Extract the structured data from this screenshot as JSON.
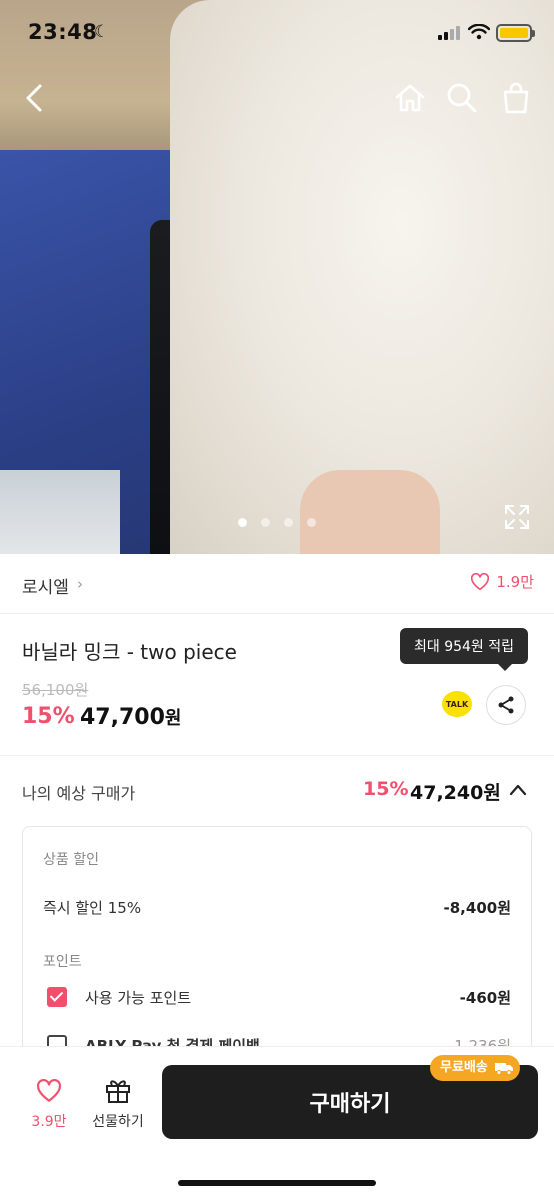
{
  "status_bar": {
    "time": "23:48"
  },
  "gallery": {
    "page_count": 4,
    "active_index": 0
  },
  "seller": {
    "name": "로시엘",
    "like_count": "1.9만"
  },
  "product": {
    "title": "바닐라 밍크 - two piece",
    "original_price": "56,100원",
    "discount_rate": "15%",
    "price_number": "47,700",
    "price_unit": "원",
    "tooltip": "최대 954원 적립",
    "talk_label": "TALK"
  },
  "estimate": {
    "label": "나의 예상 구매가",
    "discount_rate": "15%",
    "price": "47,240원"
  },
  "breakdown": {
    "discount_section": "상품 할인",
    "instant_label": "즉시 할인 15%",
    "instant_value": "-8,400원",
    "point_section": "포인트",
    "points_label": "사용 가능 포인트",
    "points_value": "-460원",
    "ablypay_label": "ABLY Pay 첫 결제 페이백",
    "ablypay_value": "-1,236원"
  },
  "bottom_bar": {
    "like_count": "3.9만",
    "gift_label": "선물하기",
    "buy_label": "구매하기",
    "free_shipping": "무료배송"
  },
  "colors": {
    "accent": "#f0506e",
    "button": "#1e1e1e",
    "badge": "#f5a623",
    "kakao": "#fae100"
  }
}
